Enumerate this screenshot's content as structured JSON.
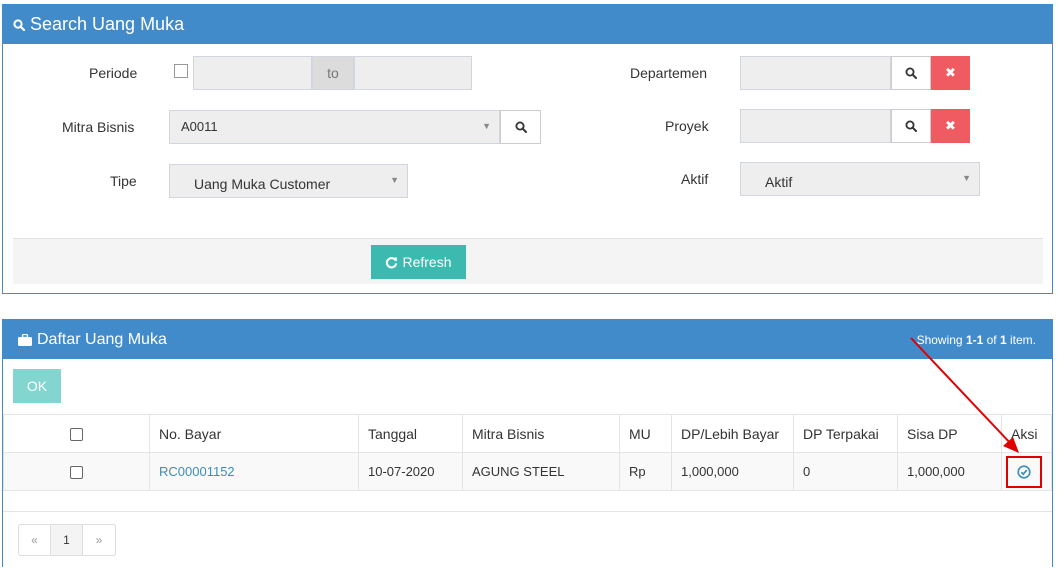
{
  "search": {
    "title": "Search Uang Muka",
    "periode_label": "Periode",
    "periode_to": "to",
    "mitra_label": "Mitra Bisnis",
    "mitra_value": "A0011",
    "tipe_label": "Tipe",
    "tipe_value": "Uang Muka Customer",
    "departemen_label": "Departemen",
    "proyek_label": "Proyek",
    "aktif_label": "Aktif",
    "aktif_value": "Aktif",
    "clear_glyph": "✖",
    "refresh_label": "Refresh"
  },
  "list": {
    "title": "Daftar Uang Muka",
    "showing_prefix": "Showing ",
    "showing_range": "1-1",
    "showing_of": " of ",
    "showing_total": "1",
    "showing_suffix": " item.",
    "ok_label": "OK",
    "columns": {
      "no_bayar": "No. Bayar",
      "tanggal": "Tanggal",
      "mitra": "Mitra Bisnis",
      "mu": "MU",
      "dp_lebih": "DP/Lebih Bayar",
      "dp_terpakai": "DP Terpakai",
      "sisa_dp": "Sisa DP",
      "aksi": "Aksi"
    },
    "rows": [
      {
        "no_bayar": "RC00001152",
        "tanggal": "10-07-2020",
        "mitra": "AGUNG STEEL",
        "mu": "Rp",
        "dp_lebih": "1,000,000",
        "dp_terpakai": "0",
        "sisa_dp": "1,000,000"
      }
    ]
  },
  "pager": {
    "prev": "«",
    "page": "1",
    "next": "»"
  },
  "colors": {
    "header_blue": "#428bca",
    "refresh_teal": "#3dbab0",
    "clear_red": "#ef5b61",
    "link_blue": "#3c8dbc",
    "annotation_red": "#e00000"
  },
  "icons": {
    "search_title": "search-icon",
    "list_title": "briefcase-icon",
    "refresh": "refresh-icon",
    "lookup": "search-icon",
    "aksi": "check-circle-icon"
  }
}
